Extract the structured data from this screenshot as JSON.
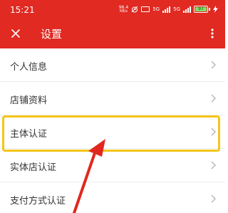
{
  "status_bar": {
    "time": "15:21",
    "net_speed_value": "96.4",
    "net_speed_unit": "KB/s",
    "network_1": "5G",
    "network_2": "5G",
    "battery_level": "97"
  },
  "toolbar": {
    "title": "设置",
    "background_color": "#e02a22"
  },
  "settings_items": [
    {
      "label": "个人信息"
    },
    {
      "label": "店铺资料"
    },
    {
      "label": "主体认证"
    },
    {
      "label": "实体店认证"
    },
    {
      "label": "支付方式认证"
    }
  ],
  "annotation": {
    "highlighted_item": "主体认证",
    "highlight_color": "#f5c518",
    "arrow_color": "#e0281e"
  }
}
